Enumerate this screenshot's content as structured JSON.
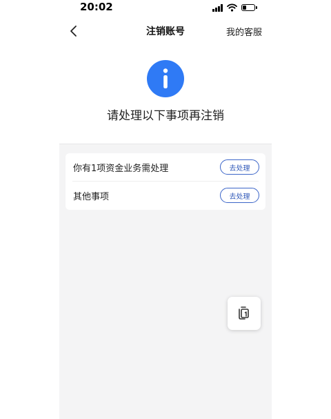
{
  "status_bar": {
    "time": "20:02",
    "battery_level_percent": 30,
    "icons": [
      "signal-icon",
      "wifi-icon",
      "battery-icon"
    ]
  },
  "nav": {
    "title": "注销账号",
    "service_label": "我的客服",
    "icons": [
      "chevron-left-icon"
    ]
  },
  "header": {
    "message": "请处理以下事项再注销",
    "icon": "info-icon",
    "accent_color": "#2f7af5"
  },
  "tasks": [
    {
      "label": "你有1项资金业务需处理",
      "button_label": "去处理"
    },
    {
      "label": "其他事项",
      "button_label": "去处理"
    }
  ],
  "colors": {
    "button_border": "#3a64c8",
    "content_background": "#f4f4f5"
  },
  "floating_button": {
    "icon": "copy-icon"
  }
}
